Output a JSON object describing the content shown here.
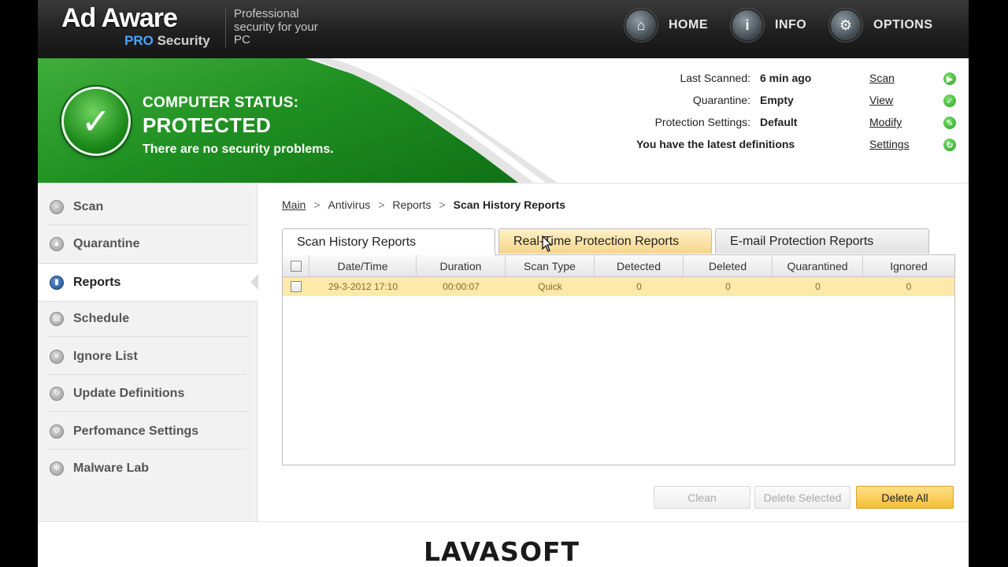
{
  "header": {
    "logo_main": "Ad Aware",
    "logo_sub_accent": "PRO",
    "logo_sub_rest": " Security",
    "tagline": "Professional security for your PC",
    "nav": [
      {
        "label": "HOME",
        "icon": "home-icon"
      },
      {
        "label": "INFO",
        "icon": "info-icon"
      },
      {
        "label": "OPTIONS",
        "icon": "gear-icon"
      }
    ]
  },
  "status": {
    "line1": "COMPUTER STATUS:",
    "line2": "PROTECTED",
    "line3": "There are no security problems.",
    "rows": [
      {
        "key": "Last Scanned:",
        "value": "6 min ago",
        "link": "Scan"
      },
      {
        "key": "Quarantine:",
        "value": "Empty",
        "link": "View"
      },
      {
        "key": "Protection Settings:",
        "value": "Default",
        "link": "Modify"
      },
      {
        "key": "",
        "value": "You have the latest definitions",
        "link": "Settings"
      }
    ]
  },
  "sidebar": {
    "items": [
      {
        "label": "Scan",
        "active": false
      },
      {
        "label": "Quarantine",
        "active": false
      },
      {
        "label": "Reports",
        "active": true
      },
      {
        "label": "Schedule",
        "active": false
      },
      {
        "label": "Ignore List",
        "active": false
      },
      {
        "label": "Update Definitions",
        "active": false
      },
      {
        "label": "Perfomance Settings",
        "active": false
      },
      {
        "label": "Malware Lab",
        "active": false
      }
    ]
  },
  "breadcrumb": [
    "Main",
    "Antivirus",
    "Reports",
    "Scan History Reports"
  ],
  "tabs": [
    "Scan History Reports",
    "Real-Time Protection Reports",
    "E-mail Protection Reports"
  ],
  "table": {
    "columns": [
      "Date/Time",
      "Duration",
      "Scan Type",
      "Detected",
      "Deleted",
      "Quarantined",
      "Ignored"
    ],
    "rows": [
      [
        "29-3-2012 17:10",
        "00:00:07",
        "Quick",
        "0",
        "0",
        "0",
        "0"
      ]
    ]
  },
  "actions": {
    "clean": "Clean",
    "delete_selected": "Delete Selected",
    "delete_all": "Delete All"
  },
  "footer": {
    "brand_first": "L",
    "brand_rest": "AVASOFT"
  },
  "colors": {
    "status_green": "#1f8f22",
    "selected_row": "#fde9a9",
    "primary_button": "#f5bd32",
    "brand_accent": "#d84a1b"
  }
}
